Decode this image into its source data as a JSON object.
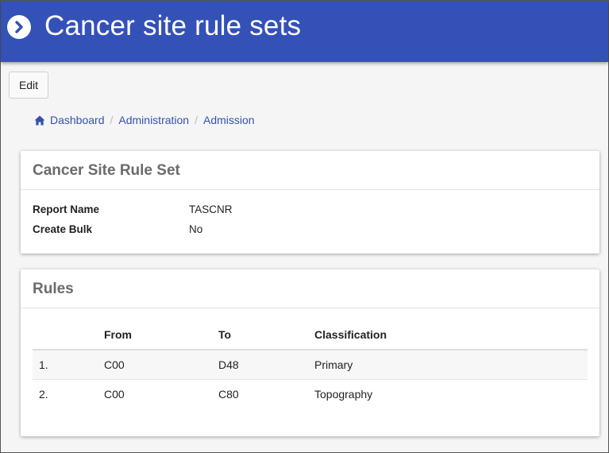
{
  "header": {
    "title": "Cancer site rule sets",
    "icon": "chevron-right-circle-icon",
    "background_color": "#3451b8"
  },
  "toolbar": {
    "edit_label": "Edit"
  },
  "breadcrumb": {
    "home_icon": "home-icon",
    "items": [
      "Dashboard",
      "Administration",
      "Admission"
    ],
    "separator": "/"
  },
  "rule_set_card": {
    "title": "Cancer Site Rule Set",
    "fields": [
      {
        "label": "Report Name",
        "value": "TASCNR"
      },
      {
        "label": "Create Bulk",
        "value": "No"
      }
    ]
  },
  "rules_card": {
    "title": "Rules",
    "columns": [
      "",
      "From",
      "To",
      "Classification"
    ],
    "rows": [
      {
        "index": "1.",
        "from": "C00",
        "to": "D48",
        "classification": "Primary"
      },
      {
        "index": "2.",
        "from": "C00",
        "to": "C80",
        "classification": "Topography"
      }
    ]
  }
}
